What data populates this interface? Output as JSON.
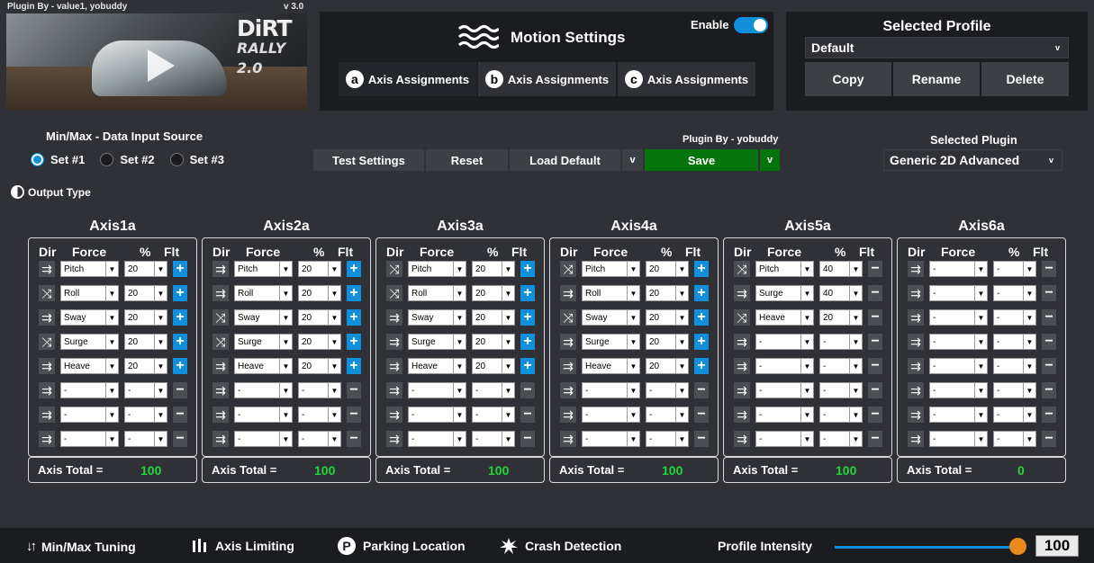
{
  "header": {
    "plugin_credit": "Plugin By - value1, yobuddy",
    "version": "v 3.0",
    "game_logo_line1": "DiRT",
    "game_logo_line2": "RALLY 2.0"
  },
  "motion": {
    "title": "Motion Settings",
    "enable_label": "Enable",
    "enable_on": true,
    "tabs": [
      {
        "letter": "a",
        "label": "Axis Assignments",
        "active": true
      },
      {
        "letter": "b",
        "label": "Axis Assignments",
        "active": false
      },
      {
        "letter": "c",
        "label": "Axis Assignments",
        "active": false
      }
    ]
  },
  "profile": {
    "title": "Selected Profile",
    "selected": "Default",
    "copy_label": "Copy",
    "rename_label": "Rename",
    "delete_label": "Delete"
  },
  "input_source": {
    "title": "Min/Max - Data Input Source",
    "options": [
      "Set #1",
      "Set #2",
      "Set #3"
    ],
    "selected_index": 0
  },
  "output_type_label": "Output Type",
  "toolbar": {
    "test_label": "Test Settings",
    "reset_label": "Reset",
    "load_default_label": "Load Default",
    "load_default_caret": "v",
    "plugin_by": "Plugin By - yobuddy",
    "save_label": "Save",
    "save_caret": "v"
  },
  "plugin_select": {
    "title": "Selected Plugin",
    "value": "Generic 2D Advanced",
    "caret": "v"
  },
  "col_headers": {
    "dir": "Dir",
    "force": "Force",
    "pct": "%",
    "flt": "Flt"
  },
  "axes": [
    {
      "name": "Axis1a",
      "total_label": "Axis Total =",
      "total": "100",
      "rows": [
        {
          "dir": "normal",
          "force": "Pitch",
          "pct": "20",
          "flt": "plus"
        },
        {
          "dir": "invert",
          "force": "Roll",
          "pct": "20",
          "flt": "plus"
        },
        {
          "dir": "normal",
          "force": "Sway",
          "pct": "20",
          "flt": "plus"
        },
        {
          "dir": "invert",
          "force": "Surge",
          "pct": "20",
          "flt": "plus"
        },
        {
          "dir": "normal",
          "force": "Heave",
          "pct": "20",
          "flt": "plus"
        },
        {
          "dir": "normal",
          "force": "-",
          "pct": "-",
          "flt": "minus"
        },
        {
          "dir": "normal",
          "force": "-",
          "pct": "-",
          "flt": "minus"
        },
        {
          "dir": "normal",
          "force": "-",
          "pct": "-",
          "flt": "minus"
        }
      ]
    },
    {
      "name": "Axis2a",
      "total_label": "Axis Total =",
      "total": "100",
      "rows": [
        {
          "dir": "normal",
          "force": "Pitch",
          "pct": "20",
          "flt": "plus"
        },
        {
          "dir": "normal",
          "force": "Roll",
          "pct": "20",
          "flt": "plus"
        },
        {
          "dir": "invert",
          "force": "Sway",
          "pct": "20",
          "flt": "plus"
        },
        {
          "dir": "invert",
          "force": "Surge",
          "pct": "20",
          "flt": "plus"
        },
        {
          "dir": "normal",
          "force": "Heave",
          "pct": "20",
          "flt": "plus"
        },
        {
          "dir": "normal",
          "force": "-",
          "pct": "-",
          "flt": "minus"
        },
        {
          "dir": "normal",
          "force": "-",
          "pct": "-",
          "flt": "minus"
        },
        {
          "dir": "normal",
          "force": "-",
          "pct": "-",
          "flt": "minus"
        }
      ]
    },
    {
      "name": "Axis3a",
      "total_label": "Axis Total =",
      "total": "100",
      "rows": [
        {
          "dir": "invert",
          "force": "Pitch",
          "pct": "20",
          "flt": "plus"
        },
        {
          "dir": "invert",
          "force": "Roll",
          "pct": "20",
          "flt": "plus"
        },
        {
          "dir": "normal",
          "force": "Sway",
          "pct": "20",
          "flt": "plus"
        },
        {
          "dir": "normal",
          "force": "Surge",
          "pct": "20",
          "flt": "plus"
        },
        {
          "dir": "normal",
          "force": "Heave",
          "pct": "20",
          "flt": "plus"
        },
        {
          "dir": "normal",
          "force": "-",
          "pct": "-",
          "flt": "minus"
        },
        {
          "dir": "normal",
          "force": "-",
          "pct": "-",
          "flt": "minus"
        },
        {
          "dir": "normal",
          "force": "-",
          "pct": "-",
          "flt": "minus"
        }
      ]
    },
    {
      "name": "Axis4a",
      "total_label": "Axis Total =",
      "total": "100",
      "rows": [
        {
          "dir": "invert",
          "force": "Pitch",
          "pct": "20",
          "flt": "plus"
        },
        {
          "dir": "normal",
          "force": "Roll",
          "pct": "20",
          "flt": "plus"
        },
        {
          "dir": "invert",
          "force": "Sway",
          "pct": "20",
          "flt": "plus"
        },
        {
          "dir": "normal",
          "force": "Surge",
          "pct": "20",
          "flt": "plus"
        },
        {
          "dir": "normal",
          "force": "Heave",
          "pct": "20",
          "flt": "plus"
        },
        {
          "dir": "normal",
          "force": "-",
          "pct": "-",
          "flt": "minus"
        },
        {
          "dir": "normal",
          "force": "-",
          "pct": "-",
          "flt": "minus"
        },
        {
          "dir": "normal",
          "force": "-",
          "pct": "-",
          "flt": "minus"
        }
      ]
    },
    {
      "name": "Axis5a",
      "total_label": "Axis Total =",
      "total": "100",
      "rows": [
        {
          "dir": "invert",
          "force": "Pitch",
          "pct": "40",
          "flt": "minus"
        },
        {
          "dir": "normal",
          "force": "Surge",
          "pct": "40",
          "flt": "minus"
        },
        {
          "dir": "invert",
          "force": "Heave",
          "pct": "20",
          "flt": "minus"
        },
        {
          "dir": "normal",
          "force": "-",
          "pct": "-",
          "flt": "minus"
        },
        {
          "dir": "normal",
          "force": "-",
          "pct": "-",
          "flt": "minus"
        },
        {
          "dir": "normal",
          "force": "-",
          "pct": "-",
          "flt": "minus"
        },
        {
          "dir": "normal",
          "force": "-",
          "pct": "-",
          "flt": "minus"
        },
        {
          "dir": "normal",
          "force": "-",
          "pct": "-",
          "flt": "minus"
        }
      ]
    },
    {
      "name": "Axis6a",
      "total_label": "Axis Total =",
      "total": "0",
      "rows": [
        {
          "dir": "normal",
          "force": "-",
          "pct": "-",
          "flt": "minus"
        },
        {
          "dir": "normal",
          "force": "-",
          "pct": "-",
          "flt": "minus"
        },
        {
          "dir": "normal",
          "force": "-",
          "pct": "-",
          "flt": "minus"
        },
        {
          "dir": "normal",
          "force": "-",
          "pct": "-",
          "flt": "minus"
        },
        {
          "dir": "normal",
          "force": "-",
          "pct": "-",
          "flt": "minus"
        },
        {
          "dir": "normal",
          "force": "-",
          "pct": "-",
          "flt": "minus"
        },
        {
          "dir": "normal",
          "force": "-",
          "pct": "-",
          "flt": "minus"
        },
        {
          "dir": "normal",
          "force": "-",
          "pct": "-",
          "flt": "minus"
        }
      ]
    }
  ],
  "footer": {
    "minmax_label": "Min/Max Tuning",
    "axis_limit_label": "Axis Limiting",
    "parking_label": "Parking Location",
    "crash_label": "Crash Detection",
    "intensity_label": "Profile Intensity",
    "intensity_value": "100",
    "intensity_fraction": 1.0
  },
  "colors": {
    "accent": "#0f8fdc",
    "save": "#07730d",
    "total": "#22d63a",
    "knob": "#e8891c"
  }
}
